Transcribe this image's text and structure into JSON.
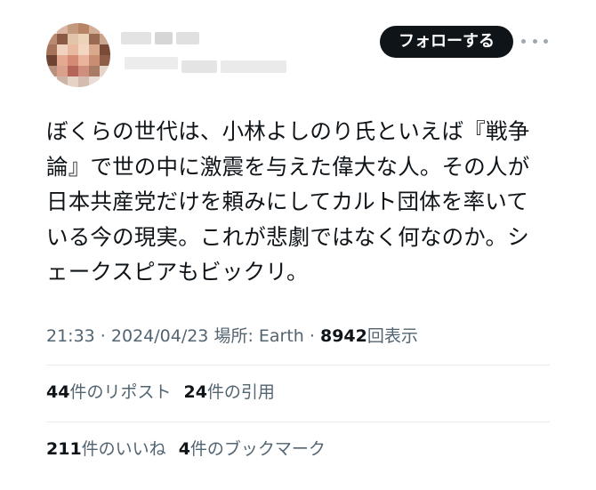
{
  "header": {
    "follow_label": "フォローする",
    "more_icon": "more-horizontal-icon"
  },
  "tweet": {
    "text": "ぼくらの世代は、小林よしのり氏といえば『戦争論』で世の中に激震を与えた偉大な人。その人が日本共産党だけを頼みにしてカルト団体を率いている今の現実。これが悲劇ではなく何なのか。シェークスピアもビックリ。",
    "time": "21:33",
    "sep1": " · ",
    "date": "2024/04/23",
    "location": " 場所: Earth",
    "sep2": " · ",
    "views_count": "8942",
    "views_label": "回表示"
  },
  "stats": {
    "reposts_count": "44",
    "reposts_label": "件のリポスト",
    "quotes_count": "24",
    "quotes_label": "件の引用",
    "likes_count": "211",
    "likes_label": "件のいいね",
    "bookmarks_count": "4",
    "bookmarks_label": "件のブックマーク"
  },
  "colors": {
    "text": "#0f1419",
    "secondary": "#536471",
    "button_bg": "#0f1419",
    "divider": "#e6ecf0"
  }
}
